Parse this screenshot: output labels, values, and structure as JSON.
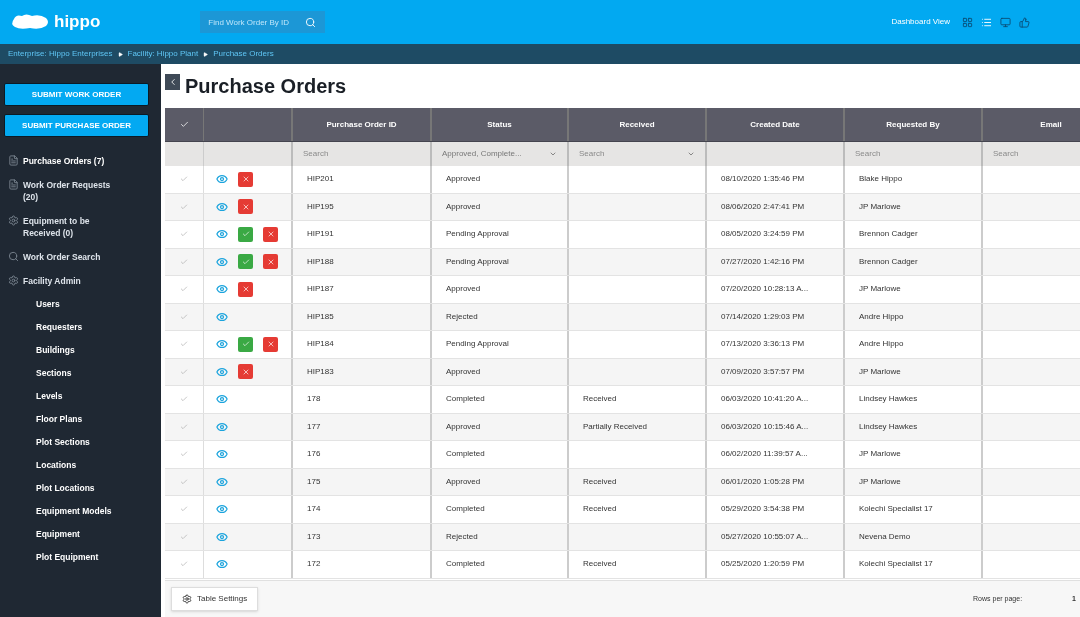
{
  "header": {
    "logo": "hippo",
    "search": {
      "placeholder": "Find Work Order By ID"
    },
    "view_label": "Dashboard View",
    "view_icons": [
      {
        "kind": "grid",
        "selected": false
      },
      {
        "kind": "list",
        "selected": true
      },
      {
        "kind": "monitor",
        "selected": false
      },
      {
        "kind": "thumb",
        "selected": false
      }
    ]
  },
  "breadcrumbs": [
    "Enterprise: Hippo Enterprises",
    "Facility: Hippo Plant",
    "Purchase Orders"
  ],
  "sidebar": {
    "buttons": [
      "SUBMIT WORK ORDER",
      "SUBMIT PURCHASE ORDER"
    ],
    "items": [
      {
        "kind": "doc",
        "label": "Purchase Orders (7)",
        "selected": true
      },
      {
        "kind": "doc",
        "label": "Work Order Requests (20)",
        "selected": false
      },
      {
        "kind": "gear",
        "label": "Equipment to be Received (0)",
        "selected": false
      },
      {
        "kind": "search",
        "label": "Work Order Search",
        "selected": false
      },
      {
        "kind": "gear",
        "label": "Facility Admin",
        "selected": false,
        "children": [
          "Users",
          "Requesters",
          "Buildings",
          "Sections",
          "Levels",
          "Floor Plans",
          "Plot Sections",
          "Locations",
          "Plot Locations",
          "Equipment Models",
          "Equipment",
          "Plot Equipment"
        ]
      }
    ]
  },
  "page_title": "Purchase Orders",
  "table": {
    "columns": [
      "Purchase Order ID",
      "Status",
      "Received",
      "Created Date",
      "Requested By",
      "Email"
    ],
    "filters": [
      {
        "kind": "text",
        "placeholder": "Search"
      },
      {
        "kind": "select",
        "value": "Approved, Complete..."
      },
      {
        "kind": "select",
        "placeholder": "Search"
      },
      {
        "kind": "empty"
      },
      {
        "kind": "text",
        "placeholder": "Search"
      },
      {
        "kind": "text",
        "placeholder": "Search"
      }
    ],
    "rows": [
      {
        "approve": false,
        "reject": true,
        "cells": [
          "HIP201",
          "Approved",
          "",
          "08/10/2020 1:35:46 PM",
          "Blake Hippo",
          ""
        ]
      },
      {
        "approve": false,
        "reject": true,
        "cells": [
          "HIP195",
          "Approved",
          "",
          "08/06/2020 2:47:41 PM",
          "JP Marlowe",
          ""
        ]
      },
      {
        "approve": true,
        "reject": true,
        "cells": [
          "HIP191",
          "Pending Approval",
          "",
          "08/05/2020 3:24:59 PM",
          "Brennon Cadger",
          ""
        ]
      },
      {
        "approve": true,
        "reject": true,
        "cells": [
          "HIP188",
          "Pending Approval",
          "",
          "07/27/2020 1:42:16 PM",
          "Brennon Cadger",
          ""
        ]
      },
      {
        "approve": false,
        "reject": true,
        "cells": [
          "HIP187",
          "Approved",
          "",
          "07/20/2020 10:28:13 A...",
          "JP Marlowe",
          ""
        ]
      },
      {
        "approve": false,
        "reject": false,
        "cells": [
          "HIP185",
          "Rejected",
          "",
          "07/14/2020 1:29:03 PM",
          "Andre Hippo",
          ""
        ]
      },
      {
        "approve": true,
        "reject": true,
        "cells": [
          "HIP184",
          "Pending Approval",
          "",
          "07/13/2020 3:36:13 PM",
          "Andre Hippo",
          ""
        ]
      },
      {
        "approve": false,
        "reject": true,
        "cells": [
          "HIP183",
          "Approved",
          "",
          "07/09/2020 3:57:57 PM",
          "JP Marlowe",
          ""
        ]
      },
      {
        "approve": false,
        "reject": false,
        "cells": [
          "178",
          "Completed",
          "Received",
          "06/03/2020 10:41:20 A...",
          "Lindsey Hawkes",
          ""
        ]
      },
      {
        "approve": false,
        "reject": false,
        "cells": [
          "177",
          "Approved",
          "Partially Received",
          "06/03/2020 10:15:46 A...",
          "Lindsey Hawkes",
          ""
        ]
      },
      {
        "approve": false,
        "reject": false,
        "cells": [
          "176",
          "Completed",
          "",
          "06/02/2020 11:39:57 A...",
          "JP Marlowe",
          ""
        ]
      },
      {
        "approve": false,
        "reject": false,
        "cells": [
          "175",
          "Approved",
          "Received",
          "06/01/2020 1:05:28 PM",
          "JP Marlowe",
          ""
        ]
      },
      {
        "approve": false,
        "reject": false,
        "cells": [
          "174",
          "Completed",
          "Received",
          "05/29/2020 3:54:38 PM",
          "Kolechi Specialist 17",
          ""
        ]
      },
      {
        "approve": false,
        "reject": false,
        "cells": [
          "173",
          "Rejected",
          "",
          "05/27/2020 10:55:07 A...",
          "Nevena Demo",
          ""
        ]
      },
      {
        "approve": false,
        "reject": false,
        "cells": [
          "172",
          "Completed",
          "Received",
          "05/25/2020 1:20:59 PM",
          "Kolechi Specialist 17",
          ""
        ]
      }
    ]
  },
  "footer": {
    "settings_button": "Table Settings",
    "rows_per_page": "Rows per page:",
    "page": "1"
  }
}
